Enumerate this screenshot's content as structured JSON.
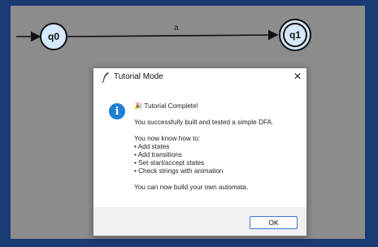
{
  "automaton": {
    "states": [
      {
        "label": "q0",
        "start": true,
        "accept": false
      },
      {
        "label": "q1",
        "start": false,
        "accept": true
      }
    ],
    "transition_label": "a"
  },
  "dialog": {
    "title": "Tutorial Mode",
    "close_glyph": "✕",
    "heading": "🎉 Tutorial Complete!",
    "line1": "You successfully built and tested a simple DFA.",
    "intro": "You now know how to:",
    "items": [
      "• Add states",
      "• Add transitions",
      "• Set start/accept states",
      "• Check strings with animation"
    ],
    "closing": "You can now build your own automata.",
    "ok_label": "OK"
  },
  "colors": {
    "background": "#1b3a73",
    "canvas": "#8c8c8c",
    "state_fill": "#d6e8fb",
    "info_icon": "#1f7fd6",
    "ok_border": "#3c78d8"
  }
}
